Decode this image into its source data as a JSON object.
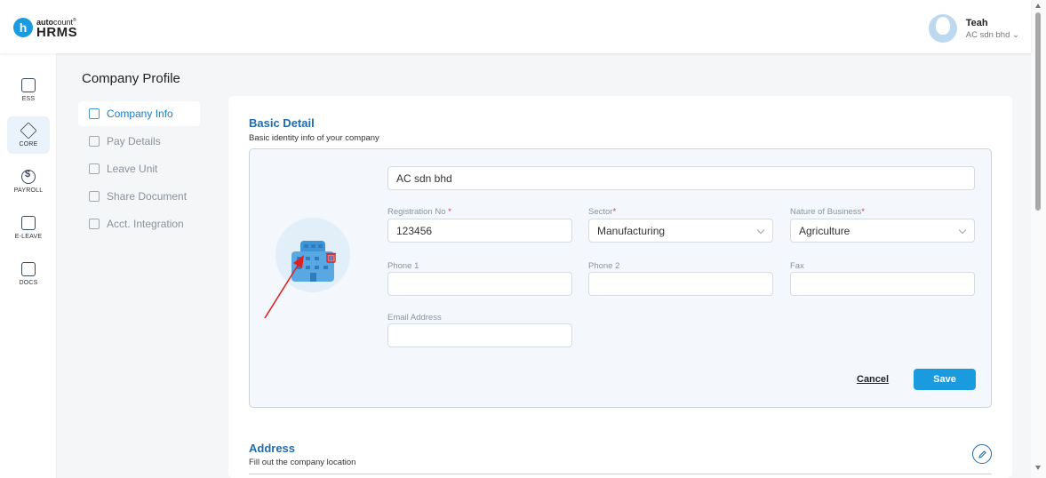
{
  "header": {
    "logo_mark": "h",
    "logo_small_bold": "auto",
    "logo_small_rest": "count",
    "logo_small_reg": "®",
    "logo_big": "HRMS",
    "user_name": "Teah",
    "user_company": "AC sdn bhd"
  },
  "rail": {
    "items": [
      {
        "label": "ESS",
        "icon": "ess-icon"
      },
      {
        "label": "CORE",
        "icon": "cube-icon",
        "active": true
      },
      {
        "label": "PAYROLL",
        "icon": "dollar-icon"
      },
      {
        "label": "E-LEAVE",
        "icon": "calendar-icon"
      },
      {
        "label": "DOCS",
        "icon": "document-chart-icon"
      }
    ]
  },
  "sidebar": {
    "title": "Company Profile",
    "items": [
      {
        "label": "Company Info",
        "icon": "building-icon",
        "active": true
      },
      {
        "label": "Pay Details",
        "icon": "pay-details-icon"
      },
      {
        "label": "Leave Unit",
        "icon": "leave-unit-icon"
      },
      {
        "label": "Share Document",
        "icon": "share-document-icon"
      },
      {
        "label": "Acct. Integration",
        "icon": "integration-icon"
      }
    ]
  },
  "basic_detail": {
    "title": "Basic Detail",
    "subtitle": "Basic identity info of your company",
    "company_name": "AC sdn bhd",
    "registration_label": "Registration No",
    "registration_value": "123456",
    "sector_label": "Sector",
    "sector_value": "Manufacturing",
    "nature_label": "Nature of Business",
    "nature_value": "Agriculture",
    "phone1_label": "Phone 1",
    "phone1_value": "",
    "phone2_label": "Phone 2",
    "phone2_value": "",
    "fax_label": "Fax",
    "fax_value": "",
    "email_label": "Email Address",
    "email_value": "",
    "required_mark": "*",
    "cancel_label": "Cancel",
    "save_label": "Save"
  },
  "address": {
    "title": "Address",
    "subtitle": "Fill out the company location"
  },
  "colors": {
    "accent": "#1a9be0",
    "title_blue": "#1f6cae",
    "required": "#e03a3a",
    "annotation_arrow": "#e02020"
  }
}
